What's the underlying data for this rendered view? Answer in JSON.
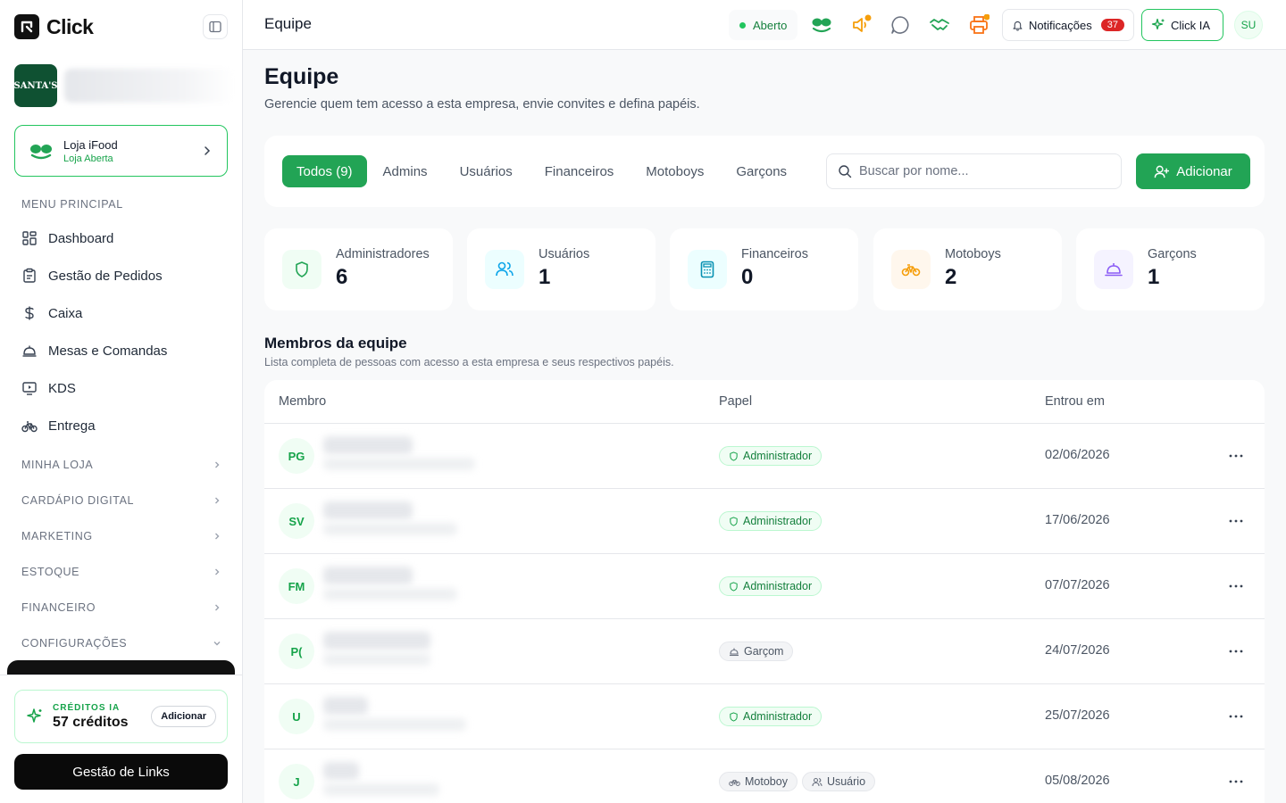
{
  "brand": {
    "name": "Click"
  },
  "company": {
    "logo_text": "SANTA'S"
  },
  "store": {
    "name": "Loja iFood",
    "status": "Loja Aberta"
  },
  "sidebar": {
    "main_title": "MENU PRINCIPAL",
    "items": [
      {
        "label": "Dashboard",
        "icon": "dashboard-icon"
      },
      {
        "label": "Gestão de Pedidos",
        "icon": "clipboard-icon"
      },
      {
        "label": "Caixa",
        "icon": "dollar-icon"
      },
      {
        "label": "Mesas e Comandas",
        "icon": "cloche-icon"
      },
      {
        "label": "KDS",
        "icon": "monitor-icon"
      },
      {
        "label": "Entrega",
        "icon": "bike-icon"
      }
    ],
    "groups": [
      {
        "label": "MINHA LOJA",
        "expanded": false
      },
      {
        "label": "CARDÁPIO DIGITAL",
        "expanded": false
      },
      {
        "label": "MARKETING",
        "expanded": false
      },
      {
        "label": "ESTOQUE",
        "expanded": false
      },
      {
        "label": "FINANCEIRO",
        "expanded": false
      },
      {
        "label": "CONFIGURAÇÕES",
        "expanded": true
      }
    ]
  },
  "credits": {
    "label": "CRÉDITOS IA",
    "value": "57 créditos",
    "add_label": "Adicionar"
  },
  "links_button": "Gestão de Links",
  "header": {
    "title": "Equipe",
    "status": "Aberto",
    "notifications_label": "Notificações",
    "notifications_count": "37",
    "ai_label": "Click IA",
    "user_initials": "SU"
  },
  "page": {
    "title": "Equipe",
    "subtitle": "Gerencie quem tem acesso a esta empresa, envie convites e defina papéis."
  },
  "filters": {
    "tabs": [
      {
        "label": "Todos (9)",
        "active": true
      },
      {
        "label": "Admins",
        "active": false
      },
      {
        "label": "Usuários",
        "active": false
      },
      {
        "label": "Financeiros",
        "active": false
      },
      {
        "label": "Motoboys",
        "active": false
      },
      {
        "label": "Garçons",
        "active": false
      }
    ],
    "search_placeholder": "Buscar por nome...",
    "add_label": "Adicionar"
  },
  "stats": [
    {
      "label": "Administradores",
      "value": "6",
      "icon": "shield-icon",
      "color": "#22a455",
      "bg": "#f0fdf4"
    },
    {
      "label": "Usuários",
      "value": "1",
      "icon": "users-icon",
      "color": "#0ea5e9",
      "bg": "#ecfeff"
    },
    {
      "label": "Financeiros",
      "value": "0",
      "icon": "calculator-icon",
      "color": "#0891b2",
      "bg": "#ecfeff"
    },
    {
      "label": "Motoboys",
      "value": "2",
      "icon": "bike-icon",
      "color": "#f59e0b",
      "bg": "#fff7ed"
    },
    {
      "label": "Garçons",
      "value": "1",
      "icon": "cloche-icon",
      "color": "#8b5cf6",
      "bg": "#f5f3ff"
    }
  ],
  "members": {
    "title": "Membros da equipe",
    "subtitle": "Lista completa de pessoas com acesso a esta empresa e seus respectivos papéis.",
    "columns": [
      "Membro",
      "Papel",
      "Entrou em"
    ],
    "rows": [
      {
        "initials": "PG",
        "roles": [
          {
            "label": "Administrador",
            "kind": "admin"
          }
        ],
        "joined": "02/06/2026"
      },
      {
        "initials": "SV",
        "roles": [
          {
            "label": "Administrador",
            "kind": "admin"
          }
        ],
        "joined": "17/06/2026"
      },
      {
        "initials": "FM",
        "roles": [
          {
            "label": "Administrador",
            "kind": "admin"
          }
        ],
        "joined": "07/07/2026"
      },
      {
        "initials": "P(",
        "roles": [
          {
            "label": "Garçom",
            "kind": "waiter"
          }
        ],
        "joined": "24/07/2026"
      },
      {
        "initials": "U",
        "roles": [
          {
            "label": "Administrador",
            "kind": "admin"
          }
        ],
        "joined": "25/07/2026"
      },
      {
        "initials": "J",
        "roles": [
          {
            "label": "Motoboy",
            "kind": "courier"
          },
          {
            "label": "Usuário",
            "kind": "user"
          }
        ],
        "joined": "05/08/2026"
      }
    ]
  }
}
